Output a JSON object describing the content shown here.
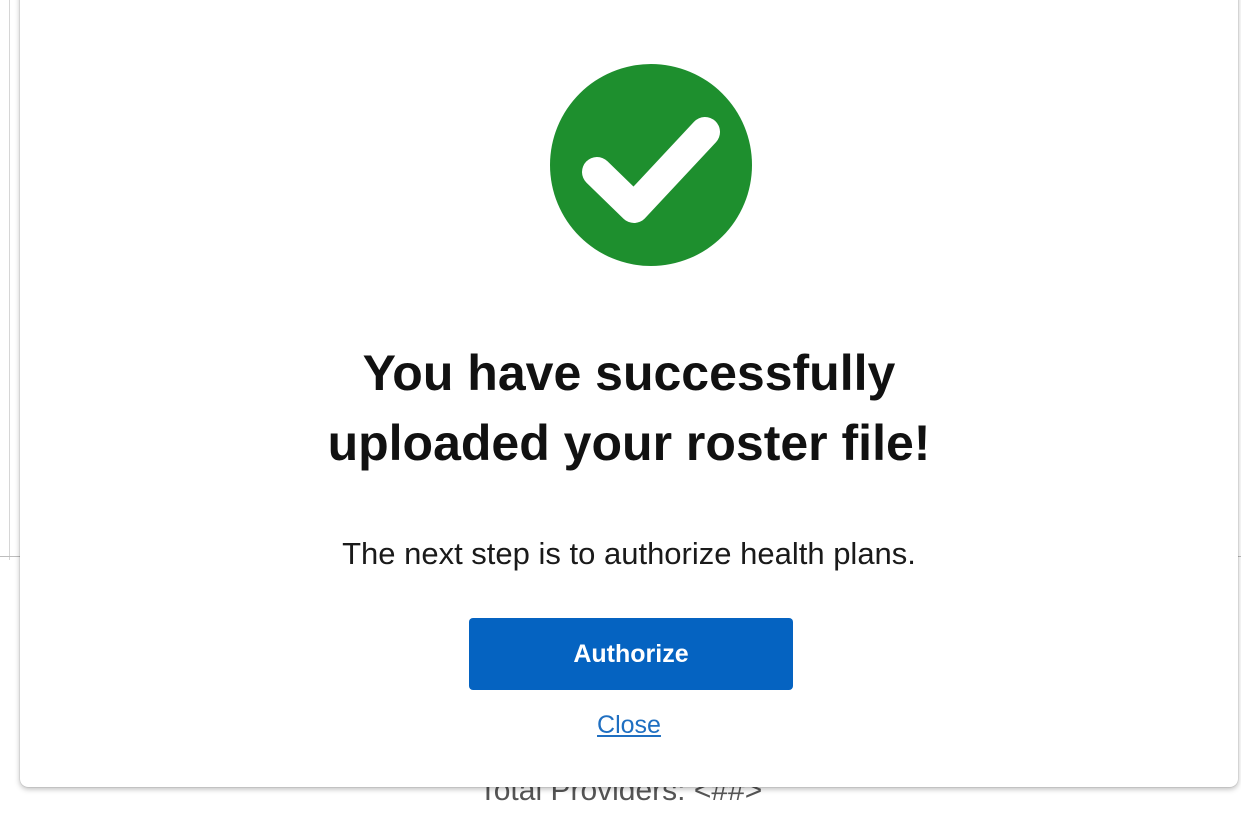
{
  "background": {
    "partial_text": "Total Providers: <##>"
  },
  "modal": {
    "icon": "check-circle-icon",
    "title_line1": "You have successfully",
    "title_line2": "uploaded your roster file!",
    "message": "The next step is to authorize health plans.",
    "primary_button": "Authorize",
    "close_link": "Close"
  },
  "colors": {
    "success": "#1e8f2e",
    "primary": "#0563c1",
    "link": "#1f6fc1"
  }
}
